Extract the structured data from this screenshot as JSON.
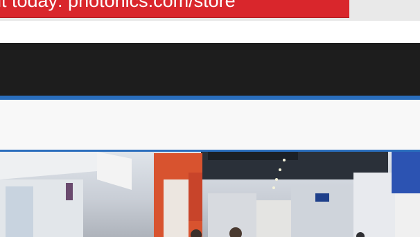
{
  "promo": {
    "text": "it today: photonics.com/store"
  },
  "colors": {
    "promo_red": "#d9262c",
    "nav_dark": "#1d1d1d",
    "accent_blue": "#2a6ebd"
  },
  "hero": {
    "subject": "trade-show-exhibition-hall"
  }
}
